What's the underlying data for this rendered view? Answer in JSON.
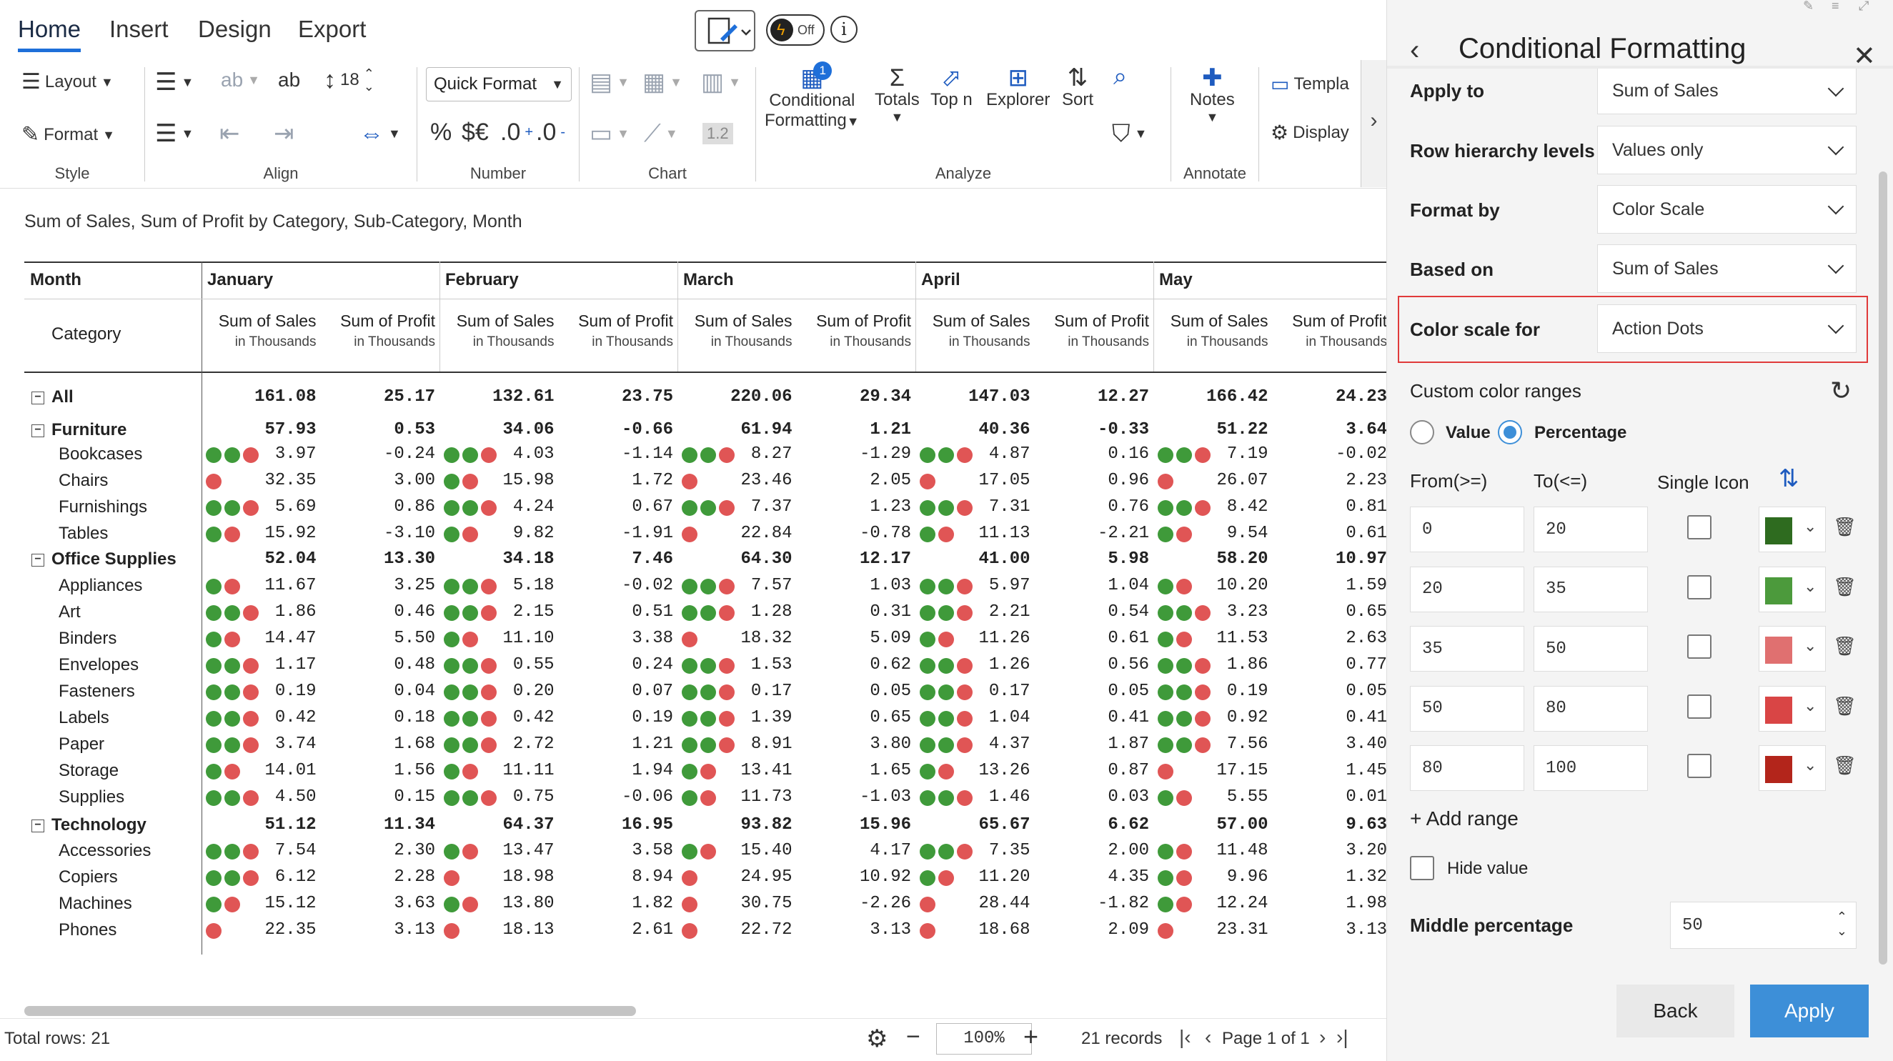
{
  "ribbon": {
    "tabs": [
      "Home",
      "Insert",
      "Design",
      "Export"
    ],
    "toggle_label": "Off",
    "style": {
      "layout": "Layout",
      "format": "Format",
      "label": "Style"
    },
    "align": {
      "font_size": "18",
      "label": "Align"
    },
    "number": {
      "quick_format": "Quick Format",
      "percent": "%",
      "currency": "$€",
      "inc_dec": ".0",
      "dec_dec": ".0",
      "label": "Number"
    },
    "chart": {
      "label": "Chart",
      "value_badge": "1.2"
    },
    "analyze": {
      "conditional": "Conditional",
      "formatting": "Formatting",
      "badge": "1",
      "totals": "Totals",
      "topn": "Top n",
      "explorer": "Explorer",
      "sort": "Sort",
      "label": "Analyze"
    },
    "annotate": {
      "notes": "Notes",
      "label": "Annotate"
    },
    "extra": {
      "templates": "Templa",
      "display": "Display"
    }
  },
  "grid": {
    "subtitle": "Sum of Sales, Sum of Profit by Category, Sub-Category, Month",
    "month_header": "Month",
    "category_header": "Category",
    "months": [
      "January",
      "February",
      "March",
      "April",
      "May"
    ],
    "measures": [
      {
        "name": "Sum of Sales",
        "unit": "in Thousands"
      },
      {
        "name": "Sum of Profit",
        "unit": "in Thousands"
      }
    ],
    "rows": [
      {
        "label": "All",
        "type": "total",
        "values": [
          "161.08",
          "25.17",
          "132.61",
          "23.75",
          "220.06",
          "29.34",
          "147.03",
          "12.27",
          "166.42",
          "24.23"
        ],
        "dots": []
      },
      {
        "label": "Furniture",
        "type": "group",
        "values": [
          "57.93",
          "0.53",
          "34.06",
          "-0.66",
          "61.94",
          "1.21",
          "40.36",
          "-0.33",
          "51.22",
          "3.64"
        ],
        "dots": []
      },
      {
        "label": "Bookcases",
        "type": "item",
        "values": [
          "3.97",
          "-0.24",
          "4.03",
          "-1.14",
          "8.27",
          "-1.29",
          "4.87",
          "0.16",
          "7.19",
          "-0.02"
        ],
        "dots": [
          "ggr",
          "ggr",
          "ggr",
          "ggr",
          "ggr"
        ]
      },
      {
        "label": "Chairs",
        "type": "item",
        "values": [
          "32.35",
          "3.00",
          "15.98",
          "1.72",
          "23.46",
          "2.05",
          "17.05",
          "0.96",
          "26.07",
          "2.23"
        ],
        "dots": [
          "r",
          "gr",
          "r",
          "r",
          "r"
        ]
      },
      {
        "label": "Furnishings",
        "type": "item",
        "values": [
          "5.69",
          "0.86",
          "4.24",
          "0.67",
          "7.37",
          "1.23",
          "7.31",
          "0.76",
          "8.42",
          "0.81"
        ],
        "dots": [
          "ggr",
          "ggr",
          "ggr",
          "ggr",
          "ggr"
        ]
      },
      {
        "label": "Tables",
        "type": "item",
        "values": [
          "15.92",
          "-3.10",
          "9.82",
          "-1.91",
          "22.84",
          "-0.78",
          "11.13",
          "-2.21",
          "9.54",
          "0.61"
        ],
        "dots": [
          "gr",
          "gr",
          "r",
          "gr",
          "gr"
        ]
      },
      {
        "label": "Office Supplies",
        "type": "group",
        "values": [
          "52.04",
          "13.30",
          "34.18",
          "7.46",
          "64.30",
          "12.17",
          "41.00",
          "5.98",
          "58.20",
          "10.97"
        ],
        "dots": []
      },
      {
        "label": "Appliances",
        "type": "item",
        "values": [
          "11.67",
          "3.25",
          "5.18",
          "-0.02",
          "7.57",
          "1.03",
          "5.97",
          "1.04",
          "10.20",
          "1.59"
        ],
        "dots": [
          "gr",
          "ggr",
          "ggr",
          "ggr",
          "gr"
        ]
      },
      {
        "label": "Art",
        "type": "item",
        "values": [
          "1.86",
          "0.46",
          "2.15",
          "0.51",
          "1.28",
          "0.31",
          "2.21",
          "0.54",
          "3.23",
          "0.65"
        ],
        "dots": [
          "ggr",
          "ggr",
          "ggr",
          "ggr",
          "ggr"
        ]
      },
      {
        "label": "Binders",
        "type": "item",
        "values": [
          "14.47",
          "5.50",
          "11.10",
          "3.38",
          "18.32",
          "5.09",
          "11.26",
          "0.61",
          "11.53",
          "2.63"
        ],
        "dots": [
          "gr",
          "gr",
          "r",
          "gr",
          "gr"
        ]
      },
      {
        "label": "Envelopes",
        "type": "item",
        "values": [
          "1.17",
          "0.48",
          "0.55",
          "0.24",
          "1.53",
          "0.62",
          "1.26",
          "0.56",
          "1.86",
          "0.77"
        ],
        "dots": [
          "ggr",
          "ggr",
          "ggr",
          "ggr",
          "ggr"
        ]
      },
      {
        "label": "Fasteners",
        "type": "item",
        "values": [
          "0.19",
          "0.04",
          "0.20",
          "0.07",
          "0.17",
          "0.05",
          "0.17",
          "0.05",
          "0.19",
          "0.05"
        ],
        "dots": [
          "ggr",
          "ggr",
          "ggr",
          "ggr",
          "ggr"
        ]
      },
      {
        "label": "Labels",
        "type": "item",
        "values": [
          "0.42",
          "0.18",
          "0.42",
          "0.19",
          "1.39",
          "0.65",
          "1.04",
          "0.41",
          "0.92",
          "0.41"
        ],
        "dots": [
          "ggr",
          "ggr",
          "ggr",
          "ggr",
          "ggr"
        ]
      },
      {
        "label": "Paper",
        "type": "item",
        "values": [
          "3.74",
          "1.68",
          "2.72",
          "1.21",
          "8.91",
          "3.80",
          "4.37",
          "1.87",
          "7.56",
          "3.40"
        ],
        "dots": [
          "ggr",
          "ggr",
          "ggr",
          "ggr",
          "ggr"
        ]
      },
      {
        "label": "Storage",
        "type": "item",
        "values": [
          "14.01",
          "1.56",
          "11.11",
          "1.94",
          "13.41",
          "1.65",
          "13.26",
          "0.87",
          "17.15",
          "1.45"
        ],
        "dots": [
          "gr",
          "gr",
          "gr",
          "gr",
          "r"
        ]
      },
      {
        "label": "Supplies",
        "type": "item",
        "values": [
          "4.50",
          "0.15",
          "0.75",
          "-0.06",
          "11.73",
          "-1.03",
          "1.46",
          "0.03",
          "5.55",
          "0.01"
        ],
        "dots": [
          "ggr",
          "ggr",
          "gr",
          "ggr",
          "gr"
        ]
      },
      {
        "label": "Technology",
        "type": "group",
        "values": [
          "51.12",
          "11.34",
          "64.37",
          "16.95",
          "93.82",
          "15.96",
          "65.67",
          "6.62",
          "57.00",
          "9.63"
        ],
        "dots": []
      },
      {
        "label": "Accessories",
        "type": "item",
        "values": [
          "7.54",
          "2.30",
          "13.47",
          "3.58",
          "15.40",
          "4.17",
          "7.35",
          "2.00",
          "11.48",
          "3.20"
        ],
        "dots": [
          "ggr",
          "gr",
          "gr",
          "ggr",
          "gr"
        ]
      },
      {
        "label": "Copiers",
        "type": "item",
        "values": [
          "6.12",
          "2.28",
          "18.98",
          "8.94",
          "24.95",
          "10.92",
          "11.20",
          "4.35",
          "9.96",
          "1.32"
        ],
        "dots": [
          "ggr",
          "r",
          "r",
          "gr",
          "gr"
        ]
      },
      {
        "label": "Machines",
        "type": "item",
        "values": [
          "15.12",
          "3.63",
          "13.80",
          "1.82",
          "30.75",
          "-2.26",
          "28.44",
          "-1.82",
          "12.24",
          "1.98"
        ],
        "dots": [
          "gr",
          "gr",
          "r",
          "r",
          "gr"
        ]
      },
      {
        "label": "Phones",
        "type": "item",
        "values": [
          "22.35",
          "3.13",
          "18.13",
          "2.61",
          "22.72",
          "3.13",
          "18.68",
          "2.09",
          "23.31",
          "3.13"
        ],
        "dots": [
          "r",
          "r",
          "r",
          "r",
          "r"
        ]
      }
    ],
    "colors": {
      "green": "#3f9a3a",
      "red": "#e05555"
    }
  },
  "status": {
    "total_rows": "Total rows: 21",
    "zoom": "100%",
    "records": "21 records",
    "page": "Page 1 of 1"
  },
  "panel": {
    "title": "Conditional Formatting",
    "apply_to": {
      "label": "Apply to",
      "value": "Sum of Sales"
    },
    "row_hierarchy": {
      "label": "Row hierarchy levels",
      "value": "Values only"
    },
    "format_by": {
      "label": "Format by",
      "value": "Color Scale"
    },
    "based_on": {
      "label": "Based on",
      "value": "Sum of Sales"
    },
    "color_scale_for": {
      "label": "Color scale for",
      "value": "Action Dots"
    },
    "custom_ranges_label": "Custom color ranges",
    "radio_value": "Value",
    "radio_percentage": "Percentage",
    "selected_radio": "Percentage",
    "from_label": "From(>=)",
    "to_label": "To(<=)",
    "single_icon_label": "Single Icon",
    "ranges": [
      {
        "from": "0",
        "to": "20",
        "color": "#2e6b1f"
      },
      {
        "from": "20",
        "to": "35",
        "color": "#4c9a3c"
      },
      {
        "from": "35",
        "to": "50",
        "color": "#e07070"
      },
      {
        "from": "50",
        "to": "80",
        "color": "#d94545"
      },
      {
        "from": "80",
        "to": "100",
        "color": "#b3251b"
      }
    ],
    "add_range": "+ Add range",
    "hide_value": "Hide value",
    "middle_percentage": {
      "label": "Middle percentage",
      "value": "50"
    },
    "back": "Back",
    "apply": "Apply",
    "accent": "#3d8fd8",
    "highlight": "#e03a3a"
  }
}
